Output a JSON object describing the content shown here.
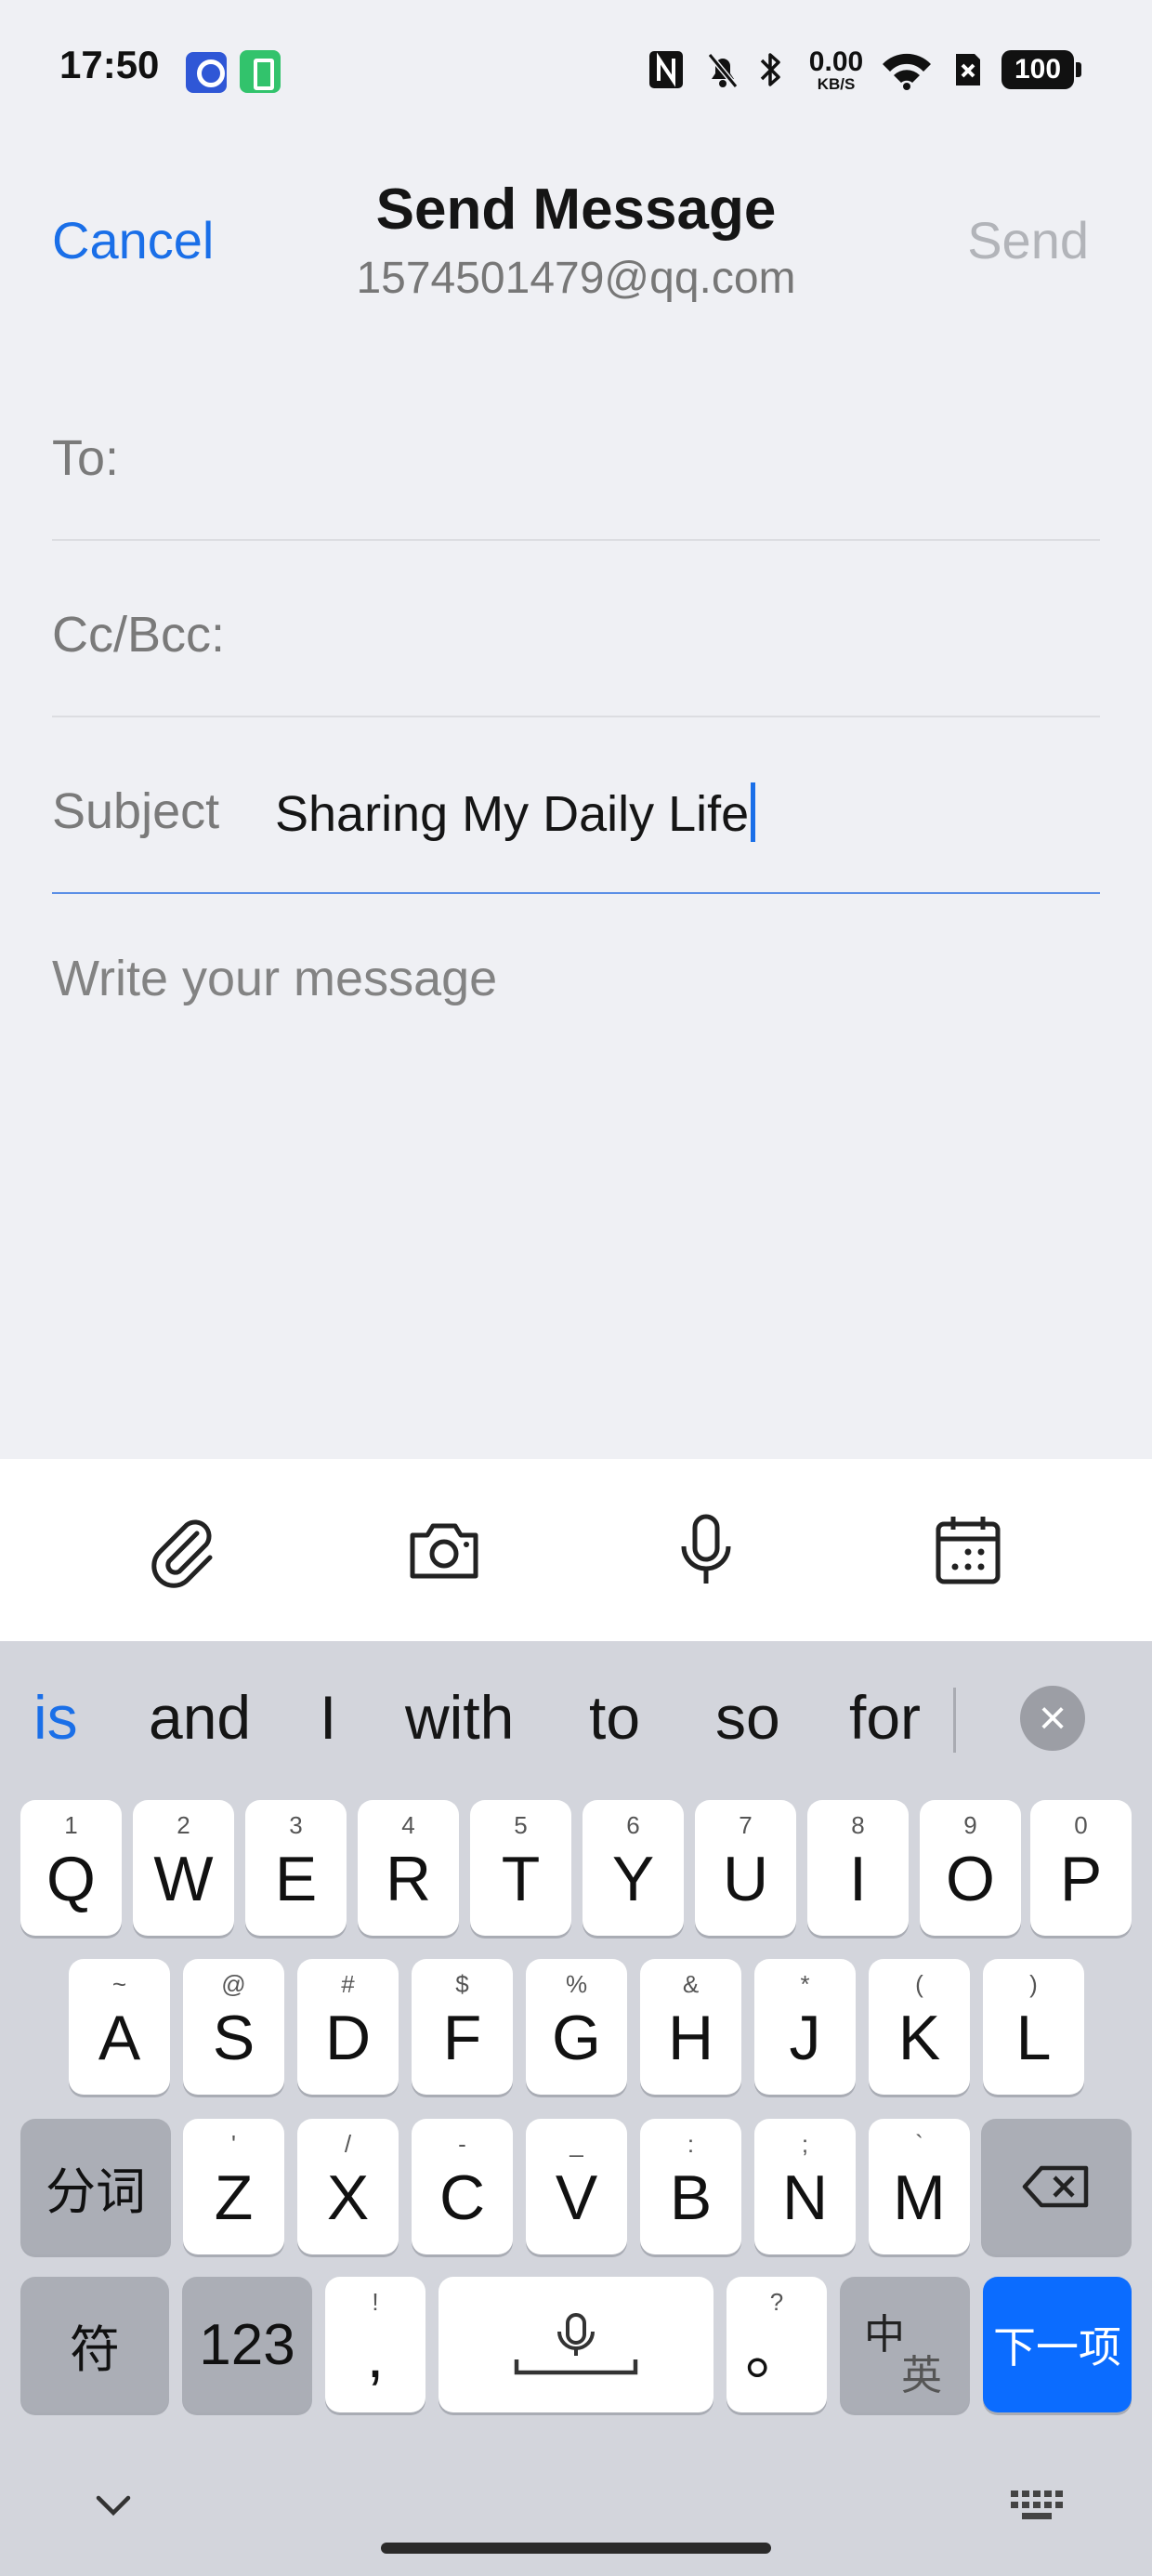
{
  "status_bar": {
    "time": "17:50",
    "net_speed_value": "0.00",
    "net_speed_unit": "KB/S",
    "battery": "100"
  },
  "header": {
    "cancel_label": "Cancel",
    "title": "Send Message",
    "account": "1574501479@qq.com",
    "send_label": "Send"
  },
  "form": {
    "to_label": "To:",
    "to_value": "",
    "cc_label": "Cc/Bcc:",
    "cc_value": "",
    "subject_label": "Subject",
    "subject_value": "Sharing My Daily Life",
    "message_placeholder": "Write your message"
  },
  "toolbar": {
    "icons": [
      "paperclip-icon",
      "camera-icon",
      "microphone-icon",
      "calendar-icon"
    ]
  },
  "keyboard": {
    "suggestions": [
      "is",
      "and",
      "I",
      "with",
      "to",
      "so",
      "for"
    ],
    "row1": [
      {
        "k": "Q",
        "s": "1"
      },
      {
        "k": "W",
        "s": "2"
      },
      {
        "k": "E",
        "s": "3"
      },
      {
        "k": "R",
        "s": "4"
      },
      {
        "k": "T",
        "s": "5"
      },
      {
        "k": "Y",
        "s": "6"
      },
      {
        "k": "U",
        "s": "7"
      },
      {
        "k": "I",
        "s": "8"
      },
      {
        "k": "O",
        "s": "9"
      },
      {
        "k": "P",
        "s": "0"
      }
    ],
    "row2": [
      {
        "k": "A",
        "s": "~"
      },
      {
        "k": "S",
        "s": "@"
      },
      {
        "k": "D",
        "s": "#"
      },
      {
        "k": "F",
        "s": "$"
      },
      {
        "k": "G",
        "s": "%"
      },
      {
        "k": "H",
        "s": "&"
      },
      {
        "k": "J",
        "s": "*"
      },
      {
        "k": "K",
        "s": "("
      },
      {
        "k": "L",
        "s": ")"
      }
    ],
    "row3": [
      {
        "k": "Z",
        "s": "'"
      },
      {
        "k": "X",
        "s": "/"
      },
      {
        "k": "C",
        "s": "-"
      },
      {
        "k": "V",
        "s": "_"
      },
      {
        "k": "B",
        "s": ":"
      },
      {
        "k": "N",
        "s": ";"
      },
      {
        "k": "M",
        "s": "`"
      }
    ],
    "segment_label": "分词",
    "symbols_label": "符",
    "numbers_label": "123",
    "comma_main": ",",
    "comma_sup": "!",
    "period_main": "。",
    "period_sup": "?",
    "lang_zh": "中",
    "lang_en": "英",
    "next_label": "下一项"
  }
}
